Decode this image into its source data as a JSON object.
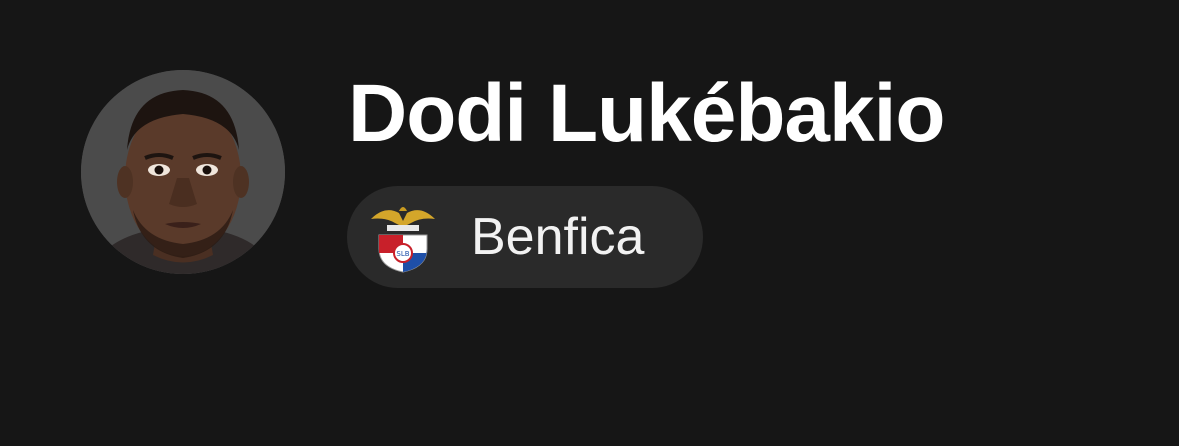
{
  "player": {
    "name": "Dodi Lukébakio",
    "team": "Benfica",
    "avatar_icon": "player-photo",
    "team_icon": "benfica-crest-icon"
  },
  "colors": {
    "background": "#161616",
    "chip": "#2a2a2a",
    "text": "#ffffff"
  }
}
